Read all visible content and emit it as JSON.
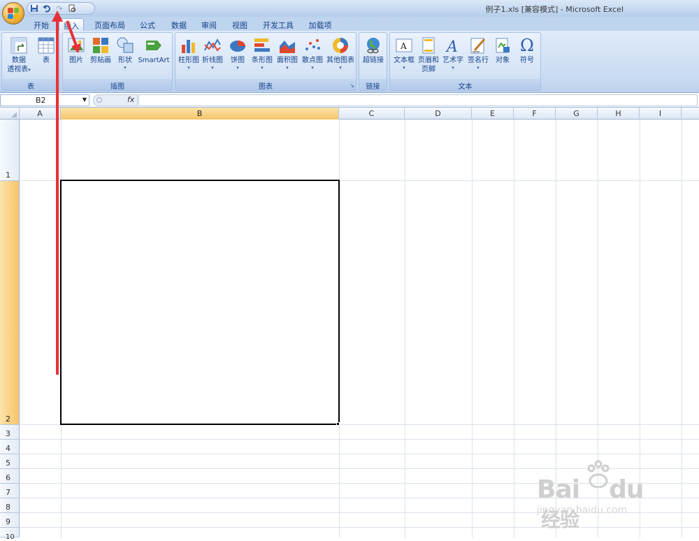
{
  "window": {
    "title": "例子1.xls  [兼容模式] - Microsoft Excel"
  },
  "tabs": [
    "开始",
    "插入",
    "页面布局",
    "公式",
    "数据",
    "审阅",
    "视图",
    "开发工具",
    "加载项"
  ],
  "active_tab": "插入",
  "ribbon": {
    "groups": {
      "table": {
        "label": "表",
        "pivot_line1": "数据",
        "pivot_line2": "透视表",
        "table": "表"
      },
      "illustrations": {
        "label": "插图",
        "picture": "图片",
        "clipart": "剪贴画",
        "shapes": "形状",
        "smartart": "SmartArt"
      },
      "charts": {
        "label": "图表",
        "column": "柱形图",
        "line": "折线图",
        "pie": "饼图",
        "bar": "条形图",
        "area": "面积图",
        "scatter": "散点图",
        "other": "其他图表"
      },
      "links": {
        "label": "链接",
        "hyperlink": "超链接"
      },
      "text": {
        "label": "文本",
        "textbox": "文本框",
        "header_line1": "页眉和",
        "header_line2": "页脚",
        "wordart": "艺术字",
        "signature": "签名行",
        "object": "对象",
        "symbol": "符号"
      }
    }
  },
  "formula_bar": {
    "name_box": "B2",
    "fx": "fx",
    "value": ""
  },
  "grid": {
    "columns": [
      "A",
      "B",
      "C",
      "D",
      "E",
      "F",
      "G",
      "H",
      "I"
    ],
    "selected_column": "B",
    "rows": [
      "1",
      "2",
      "3",
      "4",
      "5",
      "6",
      "7",
      "8",
      "9",
      "10"
    ],
    "selected_row": "2"
  },
  "watermark": {
    "brand": "Bai",
    "brand2": "du",
    "brand_cn": "经验",
    "url": "jingyan.baidu.com"
  }
}
